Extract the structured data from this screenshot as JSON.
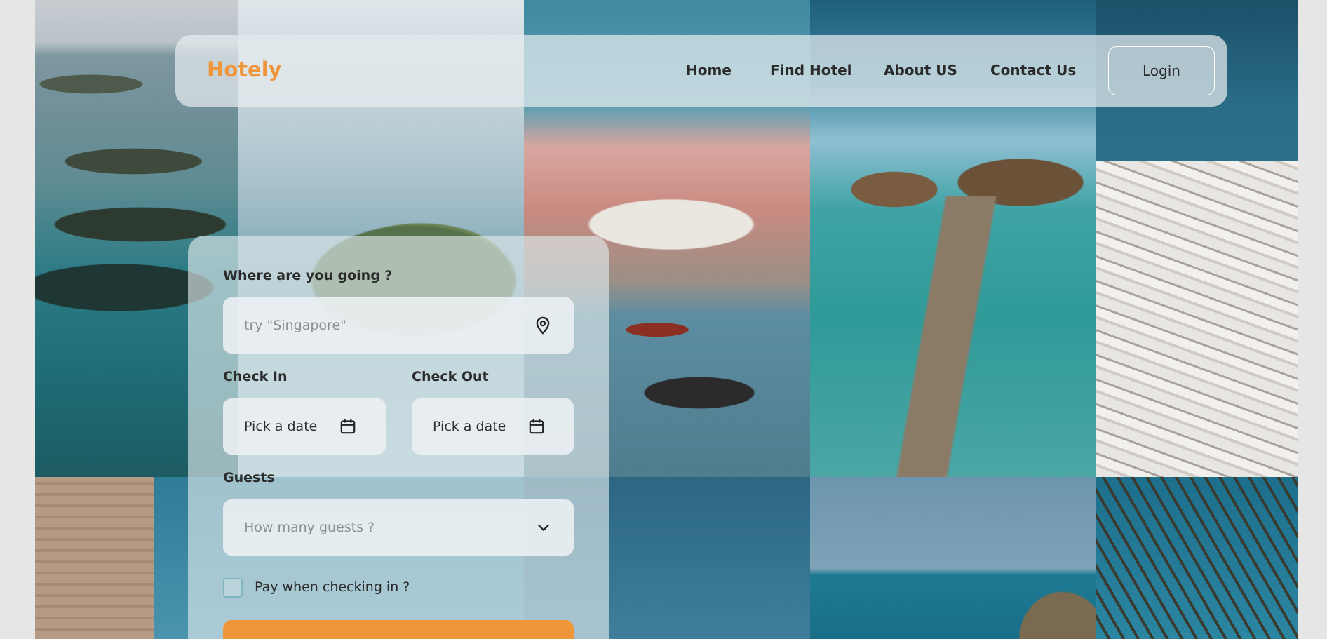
{
  "brand": {
    "name": "Hotely"
  },
  "nav": {
    "links": [
      "Home",
      "Find Hotel",
      "About US",
      "Contact Us"
    ],
    "login_label": "Login"
  },
  "search_form": {
    "destination": {
      "label": "Where are you going ?",
      "placeholder": "try \"Singapore\"",
      "icon": "location-pin-icon"
    },
    "check_in": {
      "label": "Check In",
      "value": "Pick a date",
      "icon": "calendar-icon"
    },
    "check_out": {
      "label": "Check Out",
      "value": "Pick a date",
      "icon": "calendar-icon"
    },
    "guests": {
      "label": "Guests",
      "placeholder": "How many guests ?",
      "icon": "chevron-down-icon"
    },
    "pay_on_checkin": {
      "label": "Pay when checking in ?",
      "checked": false
    }
  },
  "colors": {
    "accent": "#f0963a",
    "text": "#2a2a2a",
    "muted": "#8a8f93"
  }
}
